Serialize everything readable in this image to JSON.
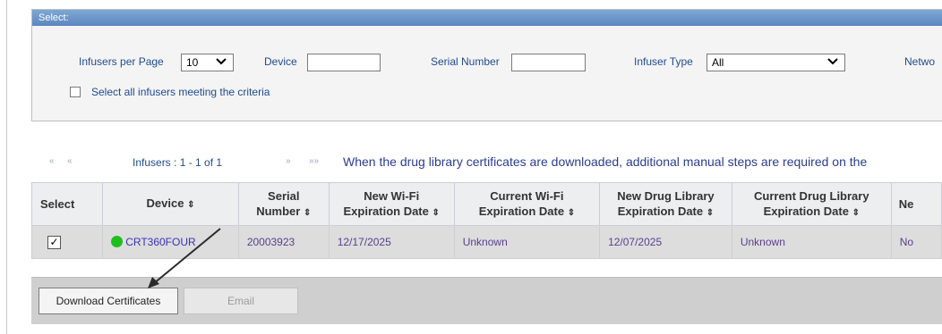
{
  "filter_panel": {
    "title": "Select:",
    "infusers_per_page_label": "Infusers per Page",
    "infusers_per_page_value": "10",
    "device_label": "Device",
    "device_value": "",
    "serial_number_label": "Serial Number",
    "serial_number_value": "",
    "infuser_type_label": "Infuser Type",
    "infuser_type_value": "All",
    "network_label": "Netwo",
    "select_all_label": "Select all infusers meeting the criteria",
    "select_all_checked": false
  },
  "pager": {
    "first": "«",
    "prev": "«",
    "summary": "Infusers : 1 - 1 of 1",
    "next": "»",
    "last": "»»"
  },
  "notice": "When the drug library certificates are downloaded, additional manual steps are required on the",
  "table": {
    "columns": [
      {
        "line1": "Select",
        "line2": "",
        "sortable": false
      },
      {
        "line1": "Device",
        "line2": "",
        "sortable": true
      },
      {
        "line1": "Serial",
        "line2": "Number",
        "sortable": true
      },
      {
        "line1": "New Wi-Fi",
        "line2": "Expiration Date",
        "sortable": true
      },
      {
        "line1": "Current Wi-Fi",
        "line2": "Expiration Date",
        "sortable": true
      },
      {
        "line1": "New Drug Library",
        "line2": "Expiration Date",
        "sortable": true
      },
      {
        "line1": "Current Drug Library",
        "line2": "Expiration Date",
        "sortable": true
      },
      {
        "line1": "Ne",
        "line2": "",
        "sortable": false
      }
    ],
    "sort_glyph": "⇕",
    "rows": [
      {
        "checked": "✓",
        "device": "CRT360FOUR",
        "serial_number": "20003923",
        "new_wifi_exp": "12/17/2025",
        "current_wifi_exp": "Unknown",
        "new_drug_lib_exp": "12/07/2025",
        "current_drug_lib_exp": "Unknown",
        "ne": "No"
      }
    ]
  },
  "buttons": {
    "download": "Download Certificates",
    "email": "Email"
  },
  "colors": {
    "header_blue": "#5b87c0",
    "link_purple": "#3a32b5",
    "status_green": "#1fbe1f"
  }
}
